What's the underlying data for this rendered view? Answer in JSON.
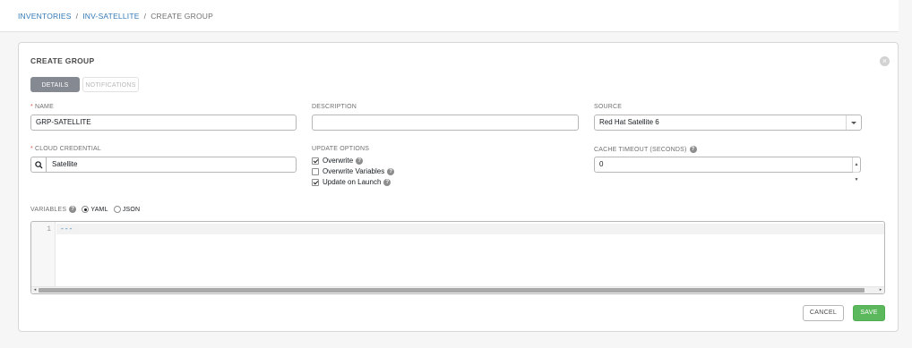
{
  "breadcrumb": {
    "items": [
      "INVENTORIES",
      "INV-SATELLITE"
    ],
    "separator": "/",
    "current": "CREATE GROUP"
  },
  "panel": {
    "title": "CREATE GROUP",
    "close_glyph": "×",
    "tabs": [
      {
        "label": "DETAILS",
        "active": true
      },
      {
        "label": "NOTIFICATIONS",
        "active": false
      }
    ]
  },
  "form": {
    "name": {
      "label": "NAME",
      "required_mark": "*",
      "value": "GRP-SATELLITE"
    },
    "description": {
      "label": "DESCRIPTION",
      "value": ""
    },
    "source": {
      "label": "SOURCE",
      "value": "Red Hat Satellite 6"
    },
    "cloud_credential": {
      "label": "CLOUD CREDENTIAL",
      "required_mark": "*",
      "value": "Satellite"
    },
    "update_options": {
      "label": "UPDATE OPTIONS",
      "items": [
        {
          "label": "Overwrite",
          "checked": true
        },
        {
          "label": "Overwrite Variables",
          "checked": false
        },
        {
          "label": "Update on Launch",
          "checked": true
        }
      ]
    },
    "cache_timeout": {
      "label": "CACHE TIMEOUT (SECONDS)",
      "value": "0"
    },
    "variables": {
      "label": "VARIABLES",
      "format_options": [
        "YAML",
        "JSON"
      ],
      "selected_format": "YAML",
      "line_number": "1",
      "code": "---"
    }
  },
  "actions": {
    "cancel": "CANCEL",
    "save": "SAVE"
  },
  "colors": {
    "link": "#337ab7",
    "save": "#5cb85c",
    "active_tab": "#848992",
    "required": "#d9534f"
  },
  "icons": [
    "close-icon",
    "search-icon",
    "help-icon",
    "caret-down-icon",
    "stepper-icon"
  ]
}
